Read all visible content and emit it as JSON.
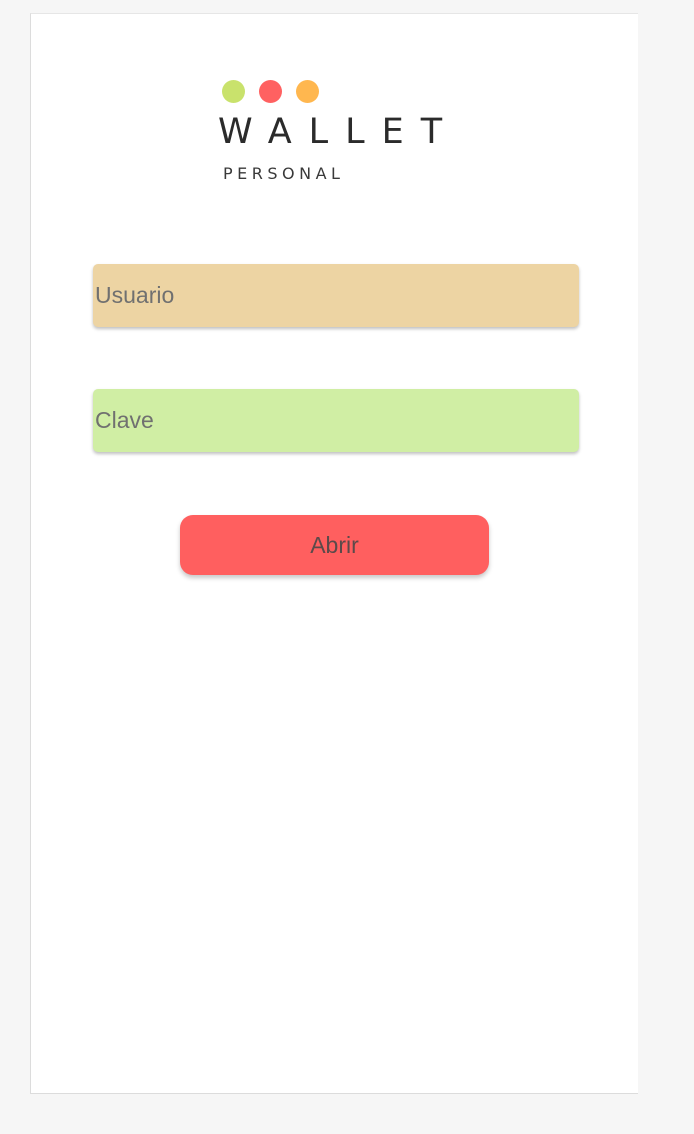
{
  "logo": {
    "brand": "WALLET",
    "subtitle": "PERSONAL",
    "dot_colors": [
      "#c9e26c",
      "#ff6161",
      "#ffb74f"
    ]
  },
  "login": {
    "username_placeholder": "Usuario",
    "username_value": "",
    "username_color": "#edd4a3",
    "password_placeholder": "Clave",
    "password_value": "",
    "password_color": "#d0eea4",
    "submit_label": "Abrir",
    "submit_color": "#ff5f5f"
  }
}
